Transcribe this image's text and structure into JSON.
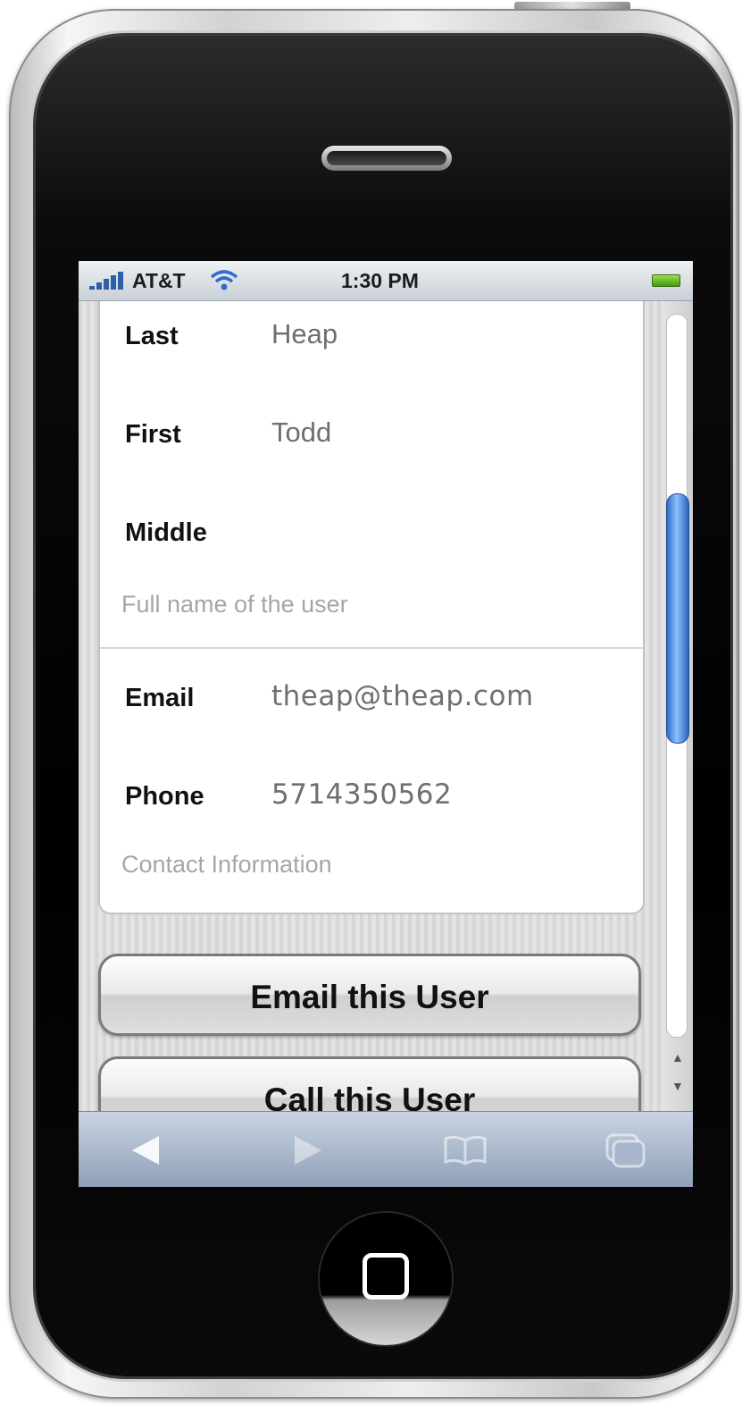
{
  "statusbar": {
    "carrier": "AT&T",
    "time": "1:30 PM"
  },
  "form": {
    "name_section": {
      "fields": [
        {
          "label": "Last",
          "value": "Heap"
        },
        {
          "label": "First",
          "value": "Todd"
        },
        {
          "label": "Middle",
          "value": ""
        }
      ],
      "caption": "Full name of the user"
    },
    "contact_section": {
      "fields": [
        {
          "label": "Email",
          "value": "theap@theap.com"
        },
        {
          "label": "Phone",
          "value": "5714350562"
        }
      ],
      "caption": "Contact Information"
    }
  },
  "buttons": {
    "email": "Email this User",
    "call": "Call this User"
  },
  "scrollbar": {
    "up_glyph": "▲",
    "down_glyph": "▼"
  },
  "toolbar": {
    "icons": [
      "back-arrow-icon",
      "forward-arrow-icon",
      "bookmarks-book-icon",
      "pages-icon"
    ]
  },
  "colors": {
    "scroll_thumb": "#4a8ae8",
    "toolbar": "#a9b7cc"
  }
}
